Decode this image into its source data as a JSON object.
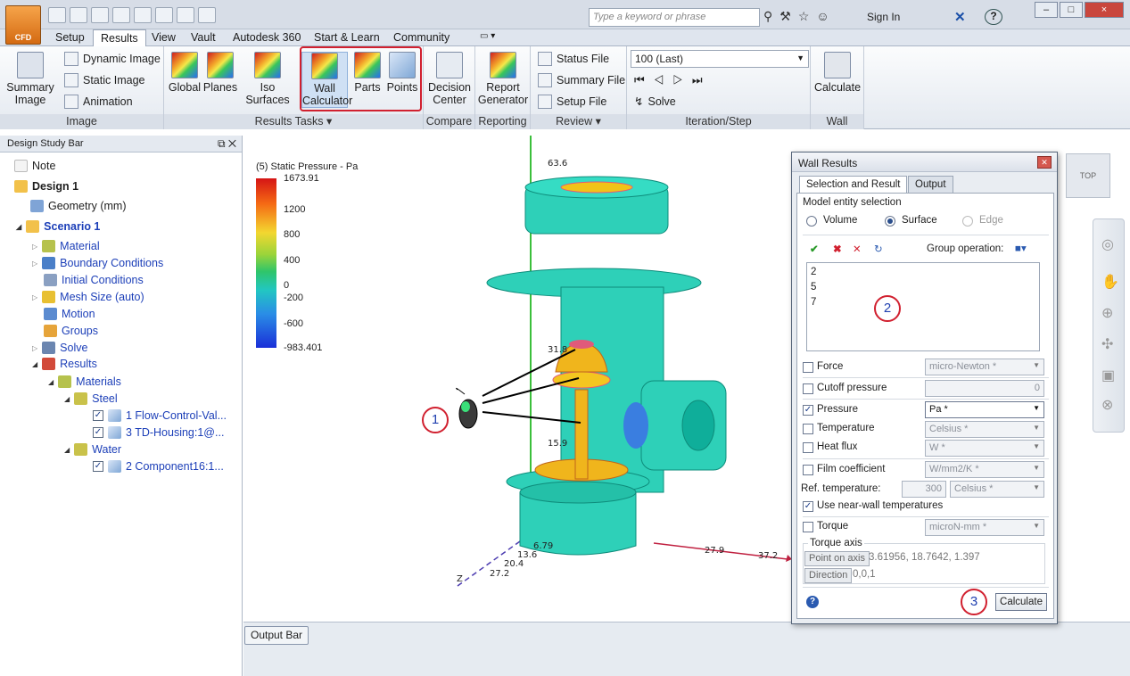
{
  "app": {
    "logo_text": "CFD",
    "search_placeholder": "Type a keyword or phrase",
    "sign_in": "Sign In",
    "help": "?"
  },
  "window_controls": [
    "–",
    "□",
    "×"
  ],
  "menu": {
    "tabs": [
      "Setup",
      "Results",
      "View",
      "Vault",
      "Autodesk 360",
      "Start & Learn",
      "Community"
    ],
    "active": "Results"
  },
  "ribbon": {
    "image_group": {
      "label": "Image",
      "summary_image": "Summary Image",
      "dynamic_image": "Dynamic Image",
      "static_image": "Static Image",
      "animation": "Animation"
    },
    "results_tasks": {
      "label": "Results Tasks ▾",
      "global": "Global",
      "planes": "Planes",
      "iso_surfaces": "Iso Surfaces",
      "wall_calculator": "Wall Calculator",
      "parts": "Parts",
      "points": "Points"
    },
    "compare": {
      "label": "Compare",
      "decision_center": "Decision Center"
    },
    "reporting": {
      "label": "Reporting",
      "report_generator": "Report Generator"
    },
    "review": {
      "label": "Review ▾",
      "status_file": "Status File",
      "summary_file": "Summary File",
      "setup_file": "Setup File"
    },
    "iteration": {
      "label": "Iteration/Step",
      "select": "100 (Last)",
      "solve": "Solve"
    },
    "wall": {
      "label": "Wall",
      "calculate": "Calculate"
    }
  },
  "design_study_bar": {
    "title": "Design Study Bar",
    "items": [
      {
        "label": "Note"
      },
      {
        "label": "Design 1"
      },
      {
        "label": "Geometry (mm)"
      },
      {
        "label": "Scenario 1"
      },
      {
        "label": "Material"
      },
      {
        "label": "Boundary Conditions"
      },
      {
        "label": "Initial Conditions"
      },
      {
        "label": "Mesh Size (auto)"
      },
      {
        "label": "Motion"
      },
      {
        "label": "Groups"
      },
      {
        "label": "Solve"
      },
      {
        "label": "Results"
      },
      {
        "label": "Materials"
      },
      {
        "label": "Steel"
      },
      {
        "label": "1 Flow-Control-Val..."
      },
      {
        "label": "3 TD-Housing:1@..."
      },
      {
        "label": "Water"
      },
      {
        "label": "2 Component16:1..."
      }
    ]
  },
  "legend": {
    "title": "(5) Static Pressure - Pa",
    "values": [
      "1673.91",
      "1200",
      "800",
      "400",
      "0",
      "-200",
      "-600",
      "-983.401"
    ]
  },
  "axis_labels": [
    "63.6",
    "31.8",
    "15.9",
    "6.79",
    "13.6",
    "20.4",
    "27.2",
    "27.9",
    "37.2",
    "Z"
  ],
  "callouts": {
    "one": "1",
    "two": "2",
    "three": "3"
  },
  "output_bar": "Output Bar",
  "wall_results": {
    "title": "Wall Results",
    "tabs": [
      "Selection and Result",
      "Output"
    ],
    "entity_selection": "Model entity selection",
    "entities": [
      "Volume",
      "Surface",
      "Edge"
    ],
    "selected_entity": "Surface",
    "group_operation": "Group operation:",
    "selected_ids": [
      "2",
      "5",
      "7"
    ],
    "rows": [
      {
        "label": "Force",
        "checked": false,
        "value": "micro-Newton *"
      },
      {
        "label": "Cutoff pressure",
        "checked": false,
        "value": "0"
      },
      {
        "label": "Pressure",
        "checked": true,
        "value": "Pa *"
      },
      {
        "label": "Temperature",
        "checked": false,
        "value": "Celsius *"
      },
      {
        "label": "Heat flux",
        "checked": false,
        "value": "W *"
      },
      {
        "label": "Film coefficient",
        "checked": false,
        "value": "W/mm2/K *"
      }
    ],
    "ref_temperature": {
      "label": "Ref. temperature:",
      "value": "300",
      "unit": "Celsius *"
    },
    "near_wall": "Use near-wall temperatures",
    "torque": {
      "label": "Torque",
      "value": "microN-mm *"
    },
    "torque_axis": "Torque axis",
    "point_on_axis": {
      "label": "Point on axis",
      "value": "3.61956, 18.7642, 1.397"
    },
    "direction": {
      "label": "Direction",
      "value": "0,0,1"
    },
    "calculate": "Calculate"
  },
  "viewcube_label": "TOP"
}
